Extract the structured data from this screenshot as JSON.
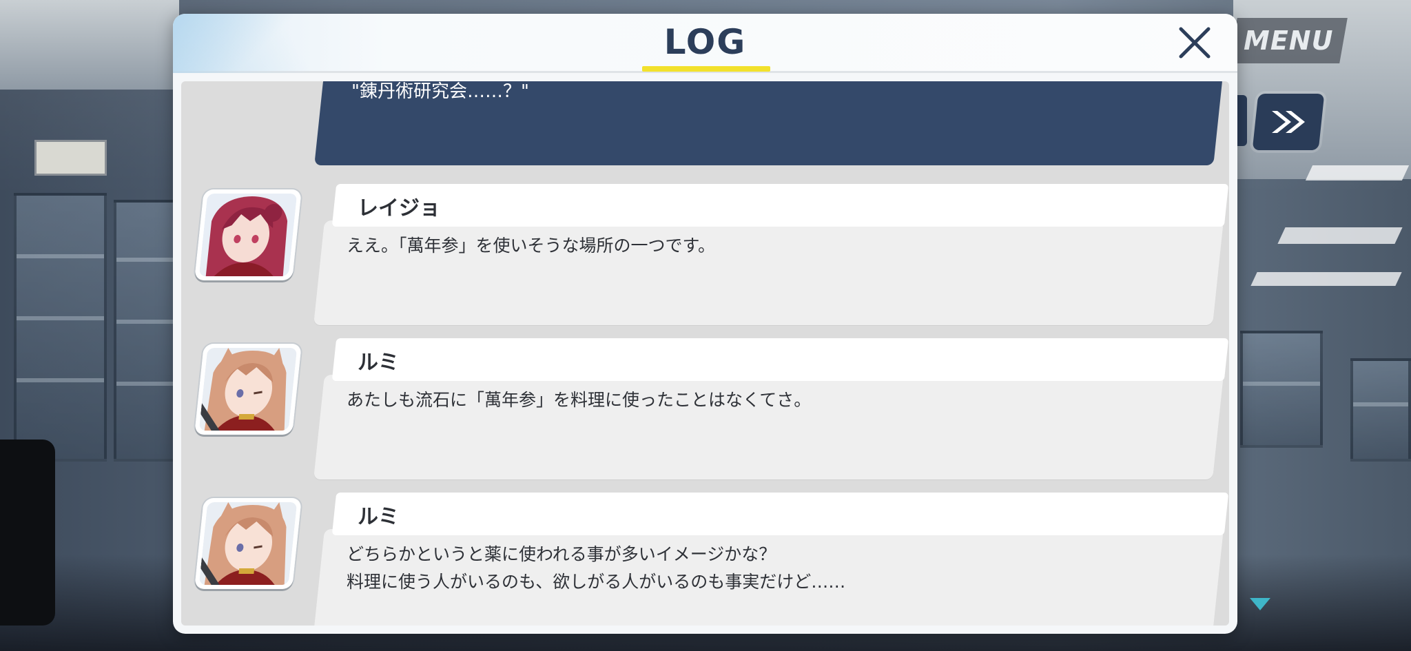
{
  "hud": {
    "menu_label": "MENU"
  },
  "log": {
    "title": "LOG",
    "accent_color": "#f2e12c",
    "partial_entry": {
      "text": "\"錬丹術研究会……？\""
    },
    "entries": [
      {
        "speaker": "レイジョ",
        "text": "ええ。「萬年参」を使いそうな場所の一つです。",
        "portrait": "reijo-portrait"
      },
      {
        "speaker": "ルミ",
        "text": "あたしも流石に「萬年参」を料理に使ったことはなくてさ。",
        "portrait": "rumi-portrait"
      },
      {
        "speaker": "ルミ",
        "text": "どちらかというと薬に使われる事が多いイメージかな？\n料理に使う人がいるのも、欲しがる人がいるのも事実だけど……",
        "portrait": "rumi-portrait"
      }
    ]
  }
}
